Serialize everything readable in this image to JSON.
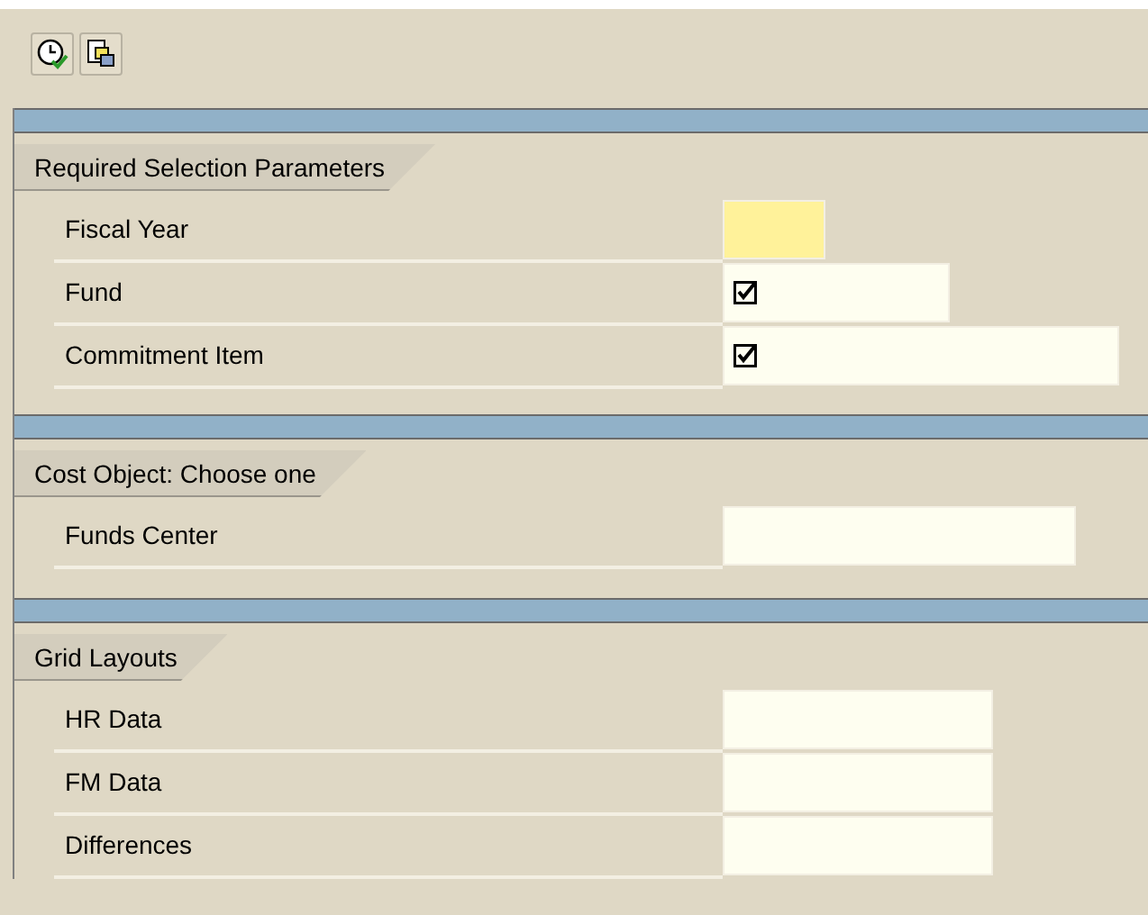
{
  "toolbar": {
    "buttons": [
      {
        "kind": "execute"
      },
      {
        "kind": "copy"
      }
    ]
  },
  "sections": [
    {
      "title": "Required Selection Parameters",
      "rows": [
        {
          "label": "Fiscal Year",
          "kind": "text",
          "required": true
        },
        {
          "label": "Fund",
          "kind": "checkbox",
          "checked": true,
          "required": false
        },
        {
          "label": "Commitment Item",
          "kind": "checkbox",
          "checked": true,
          "required": false
        }
      ]
    },
    {
      "title": "Cost Object: Choose one",
      "rows": [
        {
          "label": "Funds Center",
          "kind": "text",
          "required": false
        }
      ]
    },
    {
      "title": "Grid Layouts",
      "rows": [
        {
          "label": "HR Data",
          "kind": "text",
          "required": false
        },
        {
          "label": "FM Data",
          "kind": "text",
          "required": false
        },
        {
          "label": "Differences",
          "kind": "text",
          "required": false
        }
      ]
    }
  ]
}
